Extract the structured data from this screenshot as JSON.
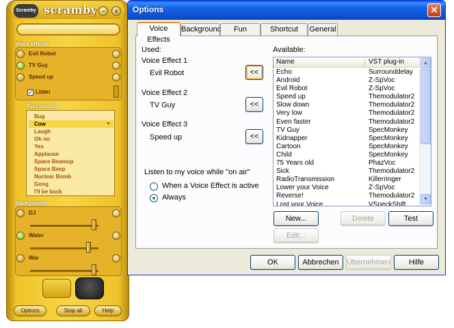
{
  "scramby": {
    "logo_badge": "Scramby",
    "brand": "scramby",
    "min_glyph": "–",
    "close_glyph": "x",
    "voice_effects_title": "Voice effects",
    "voice_effects": [
      "Evil Robot",
      "TV Guy",
      "Speed up"
    ],
    "listen_label": "Listen",
    "listen_check": "✓",
    "fun_sounds_title": "Fun sounds",
    "fun_sounds": [
      "Bug",
      "Cow",
      "Laugh",
      "Oh no",
      "Yes",
      "Applause",
      "Space Beamup",
      "Space Beep",
      "Nuclear Bomb",
      "Gong",
      "I'll be back"
    ],
    "fun_selected": "Cow",
    "fun_arrow": "▼",
    "background_title": "Background",
    "backgrounds": [
      "DJ",
      "Water",
      "War"
    ],
    "buttons": {
      "options": "Options",
      "stop_all": "Stop all",
      "help": "Help"
    }
  },
  "dialog": {
    "title": "Options",
    "close_glyph": "✕",
    "tabs": [
      "Voice Effects",
      "Background",
      "Fun Sounds",
      "Shortcut Keys",
      "General"
    ],
    "active_tab": "Voice Effects",
    "used_label": "Used:",
    "available_label": "Available:",
    "slots": [
      {
        "heading": "Voice Effect 1",
        "value": "Evil Robot",
        "button": "<<"
      },
      {
        "heading": "Voice Effect 2",
        "value": "TV Guy",
        "button": "<<"
      },
      {
        "heading": "Voice Effect 3",
        "value": "Speed up",
        "button": "<<"
      }
    ],
    "listen_group": "Listen to my voice while \"on air\"",
    "radio_options": [
      {
        "label": "When a Voice Effect is active",
        "checked": false
      },
      {
        "label": "Always",
        "checked": true
      }
    ],
    "list": {
      "columns": [
        "Name",
        "VST plug-in"
      ],
      "rows": [
        [
          "Echo",
          "Surrounddelay"
        ],
        [
          "Android",
          "Z-SpVoc"
        ],
        [
          "Evil Robot",
          "Z-SpVoc"
        ],
        [
          "Speed up",
          "Themodulator2"
        ],
        [
          "Slow down",
          "Themodulator2"
        ],
        [
          "Very low",
          "Themodulator2"
        ],
        [
          "Even faster",
          "Themodulator2"
        ],
        [
          "TV Guy",
          "SpecMonkey"
        ],
        [
          "Kidnapper",
          "SpecMonkey"
        ],
        [
          "Cartoon",
          "SpecMonkey"
        ],
        [
          "Child",
          "SpecMonkey"
        ],
        [
          "75 Years old",
          "PhazVoc"
        ],
        [
          "Sick",
          "Themodulator2"
        ],
        [
          "RadioTransmission",
          "Killerringer"
        ],
        [
          "Lower your Voice",
          "Z-SpVoc"
        ],
        [
          "Reverse!",
          "Themodulator2"
        ],
        [
          "Lost your Voice",
          "VSpeckShift"
        ]
      ],
      "scroll_up": "▲",
      "scroll_down": "▼"
    },
    "list_buttons": {
      "new": "New...",
      "delete": "Delete",
      "test": "Test",
      "edit": "Edit..."
    },
    "footer_buttons": {
      "ok": "OK",
      "cancel": "Abbrechen",
      "apply": "Übernehmen",
      "help": "Hilfe"
    }
  }
}
